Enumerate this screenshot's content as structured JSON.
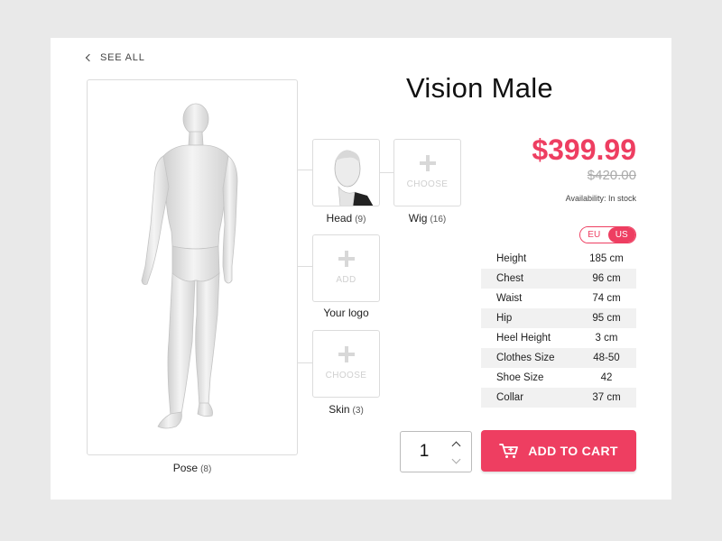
{
  "nav": {
    "see_all": "SEE ALL"
  },
  "product": {
    "title": "Vision Male",
    "price": "$399.99",
    "old_price": "$420.00",
    "availability": "Availability: In stock"
  },
  "options": {
    "pose": {
      "label": "Pose",
      "count": "(8)"
    },
    "head": {
      "label": "Head",
      "count": "(9)"
    },
    "wig": {
      "label": "Wig",
      "count": "(16)",
      "slot_text": "CHOOSE"
    },
    "logo": {
      "label": "Your logo",
      "slot_text": "ADD"
    },
    "skin": {
      "label": "Skin",
      "count": "(3)",
      "slot_text": "CHOOSE"
    }
  },
  "units": {
    "eu": "EU",
    "us": "US",
    "selected": "US"
  },
  "sizes": [
    {
      "name": "Height",
      "value": "185 cm"
    },
    {
      "name": "Chest",
      "value": "96 cm"
    },
    {
      "name": "Waist",
      "value": "74 cm"
    },
    {
      "name": "Hip",
      "value": "95 cm"
    },
    {
      "name": "Heel Height",
      "value": "3 cm"
    },
    {
      "name": "Clothes Size",
      "value": "48-50"
    },
    {
      "name": "Shoe Size",
      "value": "42"
    },
    {
      "name": "Collar",
      "value": "37 cm"
    }
  ],
  "cart": {
    "quantity": "1",
    "button_label": "ADD TO CART"
  },
  "colors": {
    "accent": "#ee3e61",
    "background": "#e9e9e9",
    "card": "#ffffff",
    "border": "#dcdcdc"
  },
  "icons": {
    "back": "chevron-left-icon",
    "plus": "plus-icon",
    "cart": "cart-icon",
    "up": "chevron-up-icon",
    "down": "chevron-down-icon"
  }
}
